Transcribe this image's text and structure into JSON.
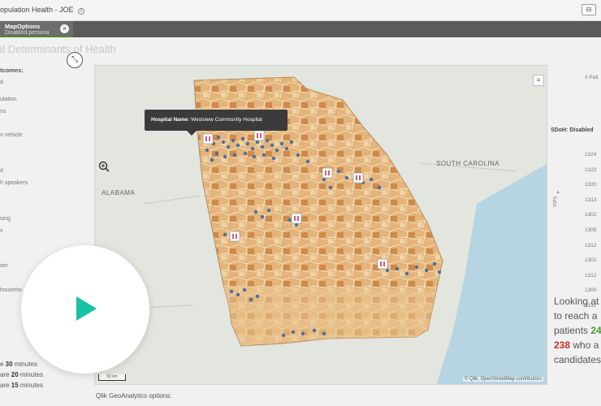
{
  "app": {
    "title": "opulation Health - JOE",
    "right_button": "⊟"
  },
  "selections": [
    {
      "title": "MapOptions",
      "value": "Disabled persona"
    }
  ],
  "sheet": {
    "title": "al Determinants of Health",
    "expand_icon": "⤡"
  },
  "left_panel": {
    "header": "tcomes:",
    "items": [
      "d",
      "ulation",
      "ns",
      "",
      "o vehicle",
      "",
      "d",
      "h speakers",
      "",
      "sing",
      "s",
      "",
      "",
      "om",
      "",
      "househo"
    ],
    "minutes": [
      {
        "pre": "e ",
        "num": "30",
        "post": " minutes"
      },
      {
        "pre": "are ",
        "num": "20",
        "post": " minutes"
      },
      {
        "pre": "are ",
        "num": "15",
        "post": " minutes"
      }
    ]
  },
  "map": {
    "tooltip_label": "Hospital Name:",
    "tooltip_value": "Westview Community Hospital",
    "labels": {
      "alabama": "ALABAMA",
      "south_carolina": "SOUTH CAROLINA"
    },
    "attribution": "© Qlik, OpenStreetMap contributors",
    "scale": "50 km",
    "zoom_icon": "search-plus-icon",
    "layer_icon": "layers-icon"
  },
  "right_panel": {
    "count_label": "# Pati",
    "sdoh_label": "SDoH: Disabled",
    "fips_axis": "FIPS",
    "fips_codes": [
      "1324",
      "1322",
      "1320",
      "1313",
      "1302",
      "1305",
      "1312",
      "1302",
      "1312",
      "1300",
      "1311"
    ],
    "summary": {
      "line1": "Looking at",
      "line2": "to reach a",
      "line3_pre": "patients ",
      "line3_num": "24",
      "line4_num": "238",
      "line4_post": " who a",
      "line5": "candidates"
    }
  },
  "footer": {
    "geo_options": "Qlik GeoAnalytics options:"
  },
  "overlay": {
    "play_icon": "play-icon",
    "accent": "#18c2a3"
  },
  "colors": {
    "selection_bar": "#5b5b5b",
    "green": "#4a9b2b",
    "red": "#c2332f"
  }
}
